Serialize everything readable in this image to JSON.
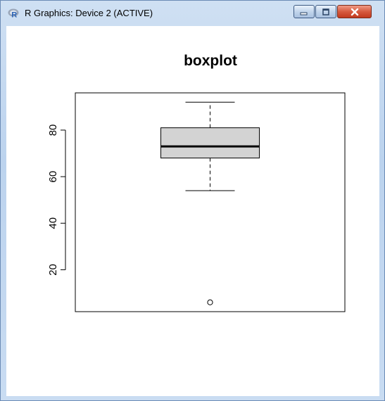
{
  "window": {
    "title": "R Graphics: Device 2 (ACTIVE)",
    "app_icon": "r-logo-icon",
    "controls": [
      "minimize-icon",
      "maximize-icon",
      "close-icon"
    ],
    "colors": {
      "close": "#c8442a",
      "box_fill": "#d3d3d3"
    }
  },
  "chart_data": {
    "type": "boxplot",
    "title": "boxplot",
    "xlabel": "",
    "ylabel": "",
    "ylim": [
      2,
      96
    ],
    "yticks": [
      20,
      40,
      60,
      80
    ],
    "stats": {
      "lower_whisker": 54,
      "q1": 68,
      "median": 73,
      "q3": 81,
      "upper_whisker": 92
    },
    "outliers": [
      6
    ]
  }
}
